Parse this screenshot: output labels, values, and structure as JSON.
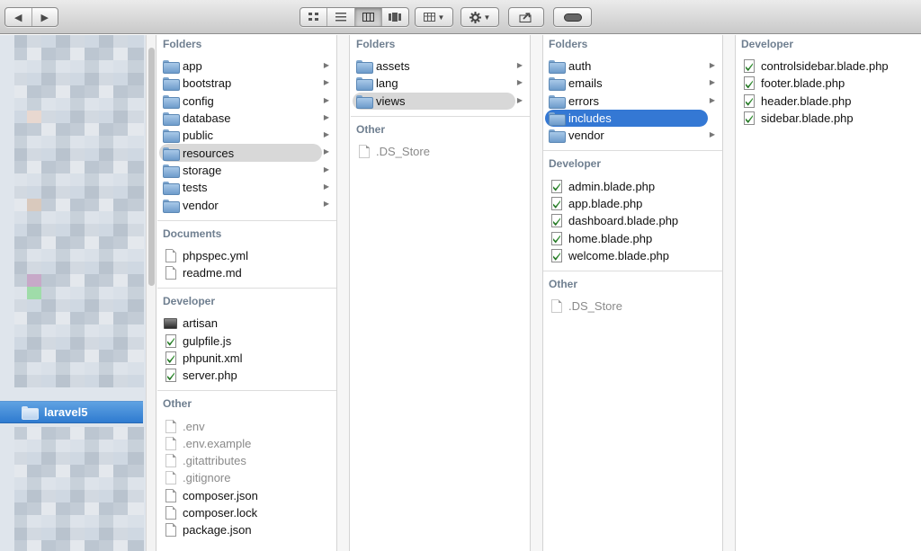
{
  "toolbar": {
    "nav": [
      "◀",
      "▶"
    ],
    "views": [
      "icon-view",
      "list-view",
      "column-view",
      "coverflow-view"
    ],
    "active_view": "column-view",
    "arrange_icon": "arrange-icon",
    "action_icon": "gear-icon",
    "share_icon": "share-icon",
    "toggle_icon": "toolbar-toggle-icon"
  },
  "sidebar": {
    "selected_label": "laravel5",
    "selected_icon": "folder-icon",
    "accent": "#2f7bd0"
  },
  "columns": [
    {
      "groups": [
        {
          "header": "Folders",
          "items": [
            {
              "label": "app",
              "icon": "folder"
            },
            {
              "label": "bootstrap",
              "icon": "folder"
            },
            {
              "label": "config",
              "icon": "folder"
            },
            {
              "label": "database",
              "icon": "folder"
            },
            {
              "label": "public",
              "icon": "folder"
            },
            {
              "label": "resources",
              "icon": "folder",
              "selected": "gray"
            },
            {
              "label": "storage",
              "icon": "folder"
            },
            {
              "label": "tests",
              "icon": "folder"
            },
            {
              "label": "vendor",
              "icon": "folder"
            }
          ]
        },
        {
          "header": "Documents",
          "items": [
            {
              "label": "phpspec.yml",
              "icon": "doc"
            },
            {
              "label": "readme.md",
              "icon": "doc"
            }
          ]
        },
        {
          "header": "Developer",
          "items": [
            {
              "label": "artisan",
              "icon": "terminal"
            },
            {
              "label": "gulpfile.js",
              "icon": "code"
            },
            {
              "label": "phpunit.xml",
              "icon": "code"
            },
            {
              "label": "server.php",
              "icon": "code"
            }
          ]
        },
        {
          "header": "Other",
          "items": [
            {
              "label": ".env",
              "icon": "faint"
            },
            {
              "label": ".env.example",
              "icon": "faint"
            },
            {
              "label": ".gitattributes",
              "icon": "faint"
            },
            {
              "label": ".gitignore",
              "icon": "faint"
            },
            {
              "label": "composer.json",
              "icon": "doc"
            },
            {
              "label": "composer.lock",
              "icon": "doc"
            },
            {
              "label": "package.json",
              "icon": "doc"
            }
          ]
        }
      ]
    },
    {
      "groups": [
        {
          "header": "Folders",
          "items": [
            {
              "label": "assets",
              "icon": "folder"
            },
            {
              "label": "lang",
              "icon": "folder"
            },
            {
              "label": "views",
              "icon": "folder",
              "selected": "gray"
            }
          ]
        },
        {
          "header": "Other",
          "items": [
            {
              "label": ".DS_Store",
              "icon": "faint"
            }
          ]
        }
      ]
    },
    {
      "groups": [
        {
          "header": "Folders",
          "items": [
            {
              "label": "auth",
              "icon": "folder"
            },
            {
              "label": "emails",
              "icon": "folder"
            },
            {
              "label": "errors",
              "icon": "folder"
            },
            {
              "label": "includes",
              "icon": "folder",
              "selected": "blue"
            },
            {
              "label": "vendor",
              "icon": "folder"
            }
          ]
        },
        {
          "header": "Developer",
          "items": [
            {
              "label": "admin.blade.php",
              "icon": "code"
            },
            {
              "label": "app.blade.php",
              "icon": "code"
            },
            {
              "label": "dashboard.blade.php",
              "icon": "code"
            },
            {
              "label": "home.blade.php",
              "icon": "code"
            },
            {
              "label": "welcome.blade.php",
              "icon": "code"
            }
          ]
        },
        {
          "header": "Other",
          "items": [
            {
              "label": ".DS_Store",
              "icon": "faint"
            }
          ]
        }
      ]
    },
    {
      "groups": [
        {
          "header": "Developer",
          "items": [
            {
              "label": "controlsidebar.blade.php",
              "icon": "code"
            },
            {
              "label": "footer.blade.php",
              "icon": "code"
            },
            {
              "label": "header.blade.php",
              "icon": "code"
            },
            {
              "label": "sidebar.blade.php",
              "icon": "code"
            }
          ]
        }
      ]
    }
  ],
  "colors": {
    "group_header": "#6f7f90",
    "selection_blue": "#3478d4",
    "selection_gray": "#d8d8d8",
    "muted_text": "#8a8a8a"
  }
}
